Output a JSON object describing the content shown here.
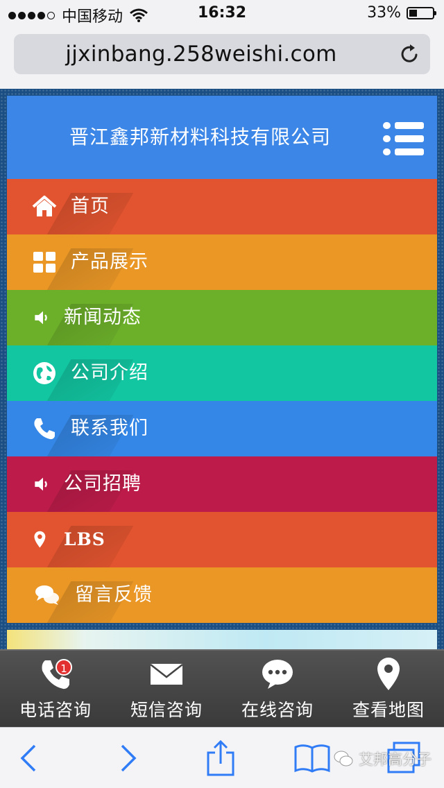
{
  "status_bar": {
    "carrier": "中国移动",
    "time": "16:32",
    "battery": "33%",
    "battery_level": 0.33,
    "signal_strength": 4
  },
  "browser": {
    "url": "jjxinbang.258weishi.com"
  },
  "site": {
    "title": "晋江鑫邦新材料科技有限公司",
    "nav": [
      {
        "label": "首页",
        "icon": "home-icon",
        "color": "#e2542f"
      },
      {
        "label": "产品展示",
        "icon": "grid-icon",
        "color": "#ea9726"
      },
      {
        "label": "新闻动态",
        "icon": "speaker-icon",
        "color": "#6cb02a"
      },
      {
        "label": "公司介绍",
        "icon": "globe-icon",
        "color": "#12c6a2"
      },
      {
        "label": "联系我们",
        "icon": "phone-icon",
        "color": "#3487e6"
      },
      {
        "label": "公司招聘",
        "icon": "speaker-icon",
        "color": "#bd1c4a"
      },
      {
        "label": "LBS",
        "icon": "map-pin-icon",
        "color": "#e2542f"
      },
      {
        "label": "留言反馈",
        "icon": "chat-icon",
        "color": "#ea9726"
      }
    ]
  },
  "contact_bar": {
    "items": [
      {
        "label": "电话咨询",
        "icon": "phone-icon",
        "badge": "1"
      },
      {
        "label": "短信咨询",
        "icon": "envelope-icon"
      },
      {
        "label": "在线咨询",
        "icon": "chat-bubble-icon"
      },
      {
        "label": "查看地图",
        "icon": "map-pin-icon"
      }
    ]
  },
  "watermark": {
    "text": "艾邦高分子"
  }
}
